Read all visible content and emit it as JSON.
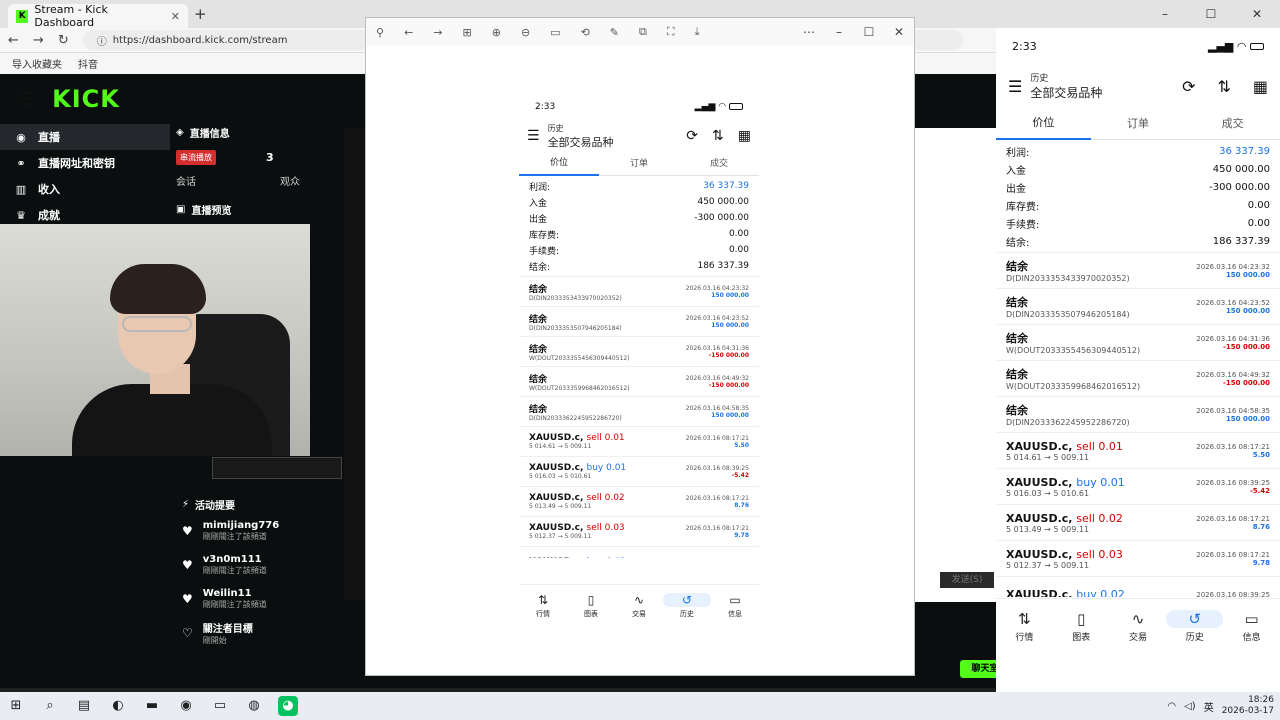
{
  "browser": {
    "tab_title": "Stream - Kick Dashboard",
    "url": "https://dashboard.kick.com/stream",
    "bookmarks": [
      "导入收藏夹",
      "抖音"
    ],
    "newtab": "+"
  },
  "kick": {
    "logo": "KICK",
    "sidebar": [
      {
        "icon": "radio-icon",
        "label": "直播"
      },
      {
        "icon": "link-icon",
        "label": "直播网址和密钥"
      },
      {
        "icon": "chart-icon",
        "label": "收入"
      },
      {
        "icon": "trophy-icon",
        "label": "成就"
      }
    ],
    "panel_title": "直播信息",
    "badge": "串流播放",
    "viewers": "3",
    "viewers_label": "观众",
    "session_label": "会话",
    "preview_label": "直播预览",
    "activity_title": "活动提要",
    "activity": [
      {
        "name": "mimijiang776",
        "sub": "剛剛關注了該頻道"
      },
      {
        "name": "v3n0m111",
        "sub": "剛剛關注了該頻道"
      },
      {
        "name": "Weilin11",
        "sub": "剛剛關注了該頻道"
      },
      {
        "name": "關注者目標",
        "sub": "剛開始"
      }
    ],
    "chat_button": "聊天室",
    "send_button": "发送(S)"
  },
  "phone": {
    "time": "2:33",
    "header_small": "历史",
    "header_main": "全部交易品种",
    "tabs": [
      "价位",
      "订单",
      "成交"
    ],
    "summary": [
      {
        "label": "利润:",
        "value": "36 337.39",
        "blue": true
      },
      {
        "label": "入金",
        "value": "450 000.00",
        "blue": false
      },
      {
        "label": "出金",
        "value": "-300 000.00",
        "blue": false
      },
      {
        "label": "库存费:",
        "value": "0.00",
        "blue": false
      },
      {
        "label": "手续费:",
        "value": "0.00",
        "blue": false
      },
      {
        "label": "结余:",
        "value": "186 337.39",
        "blue": false
      }
    ],
    "entries": [
      {
        "title": "结余",
        "title2": "",
        "sub": "D(DIN2033353433970020352)",
        "date": "2026.03.16 04:23:32",
        "amount": "150 000.00",
        "color": "blue"
      },
      {
        "title": "结余",
        "title2": "",
        "sub": "D(DIN2033353507946205184)",
        "date": "2026.03.16 04:23:52",
        "amount": "150 000.00",
        "color": "blue"
      },
      {
        "title": "结余",
        "title2": "",
        "sub": "W(DOUT2033355456309440512)",
        "date": "2026.03.16 04:31:36",
        "amount": "-150 000.00",
        "color": "red"
      },
      {
        "title": "结余",
        "title2": "",
        "sub": "W(DOUT2033359968462016512)",
        "date": "2026.03.16 04:49:32",
        "amount": "-150 000.00",
        "color": "red"
      },
      {
        "title": "结余",
        "title2": "",
        "sub": "D(DIN2033362245952286720)",
        "date": "2026.03.16 04:58:35",
        "amount": "150 000.00",
        "color": "blue"
      },
      {
        "title": "XAUUSD.c,",
        "title2": "sell 0.01",
        "t2color": "red",
        "sub": "5 014.61 → 5 009.11",
        "date": "2026.03.16 08:17:21",
        "amount": "5.50",
        "color": "blue"
      },
      {
        "title": "XAUUSD.c,",
        "title2": "buy 0.01",
        "t2color": "blue",
        "sub": "5 016.03 → 5 010.61",
        "date": "2026.03.16 08:39:25",
        "amount": "-5.42",
        "color": "red"
      },
      {
        "title": "XAUUSD.c,",
        "title2": "sell 0.02",
        "t2color": "red",
        "sub": "5 013.49 → 5 009.11",
        "date": "2026.03.16 08:17:21",
        "amount": "8.76",
        "color": "blue"
      },
      {
        "title": "XAUUSD.c,",
        "title2": "sell 0.03",
        "t2color": "red",
        "sub": "5 012.37 → 5 009.11",
        "date": "2026.03.16 08:17:21",
        "amount": "9.78",
        "color": "blue"
      },
      {
        "title": "XAUUSD.c,",
        "title2": "buy 0.02",
        "t2color": "blue",
        "sub": "",
        "date": "2026.03.16 08:39:25",
        "amount": "",
        "color": "blue"
      }
    ],
    "bottom_nav": [
      {
        "icon": "⇅",
        "label": "行情"
      },
      {
        "icon": "▯",
        "label": "图表"
      },
      {
        "icon": "∿",
        "label": "交易"
      },
      {
        "icon": "↺",
        "label": "历史"
      },
      {
        "icon": "▭",
        "label": "信息"
      }
    ]
  },
  "taskbar": {
    "time": "18:26",
    "date": "2026-03-17",
    "lang": "英"
  }
}
